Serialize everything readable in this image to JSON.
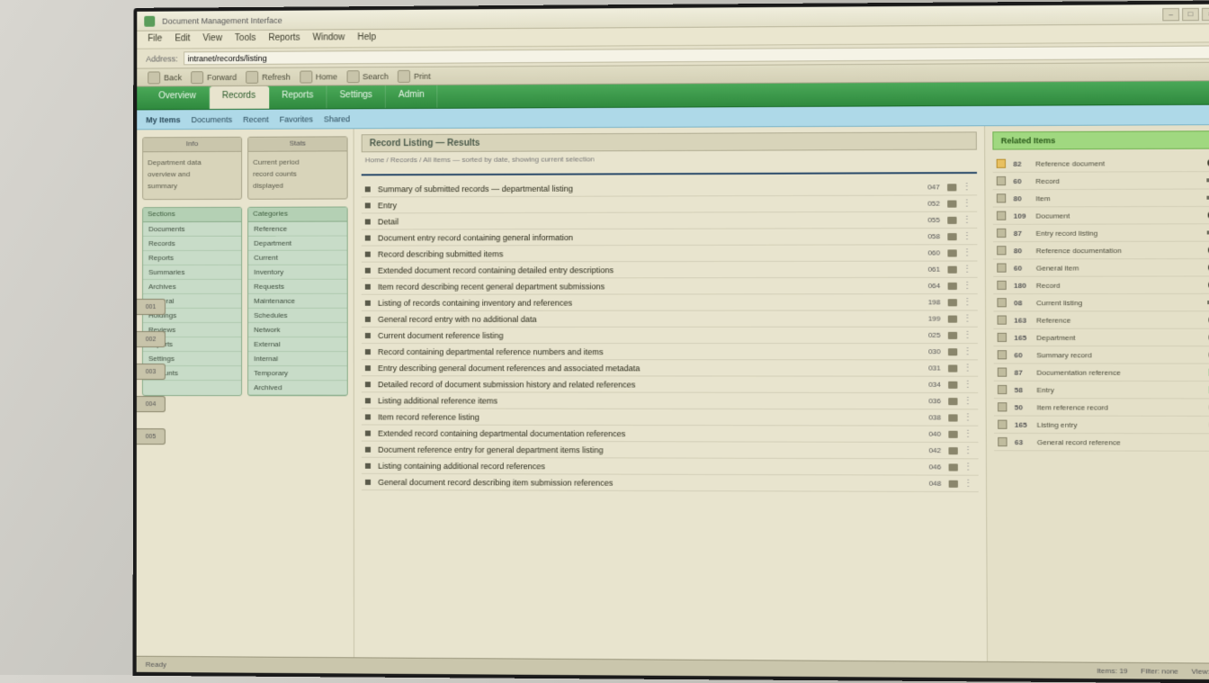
{
  "titlebar": {
    "text": "Document Management Interface"
  },
  "menubar": [
    "File",
    "Edit",
    "View",
    "Tools",
    "Reports",
    "Window",
    "Help"
  ],
  "address": {
    "label": "Address:",
    "value": "intranet/records/listing"
  },
  "toolbar": [
    "Back",
    "Forward",
    "Refresh",
    "Home",
    "Search",
    "Print"
  ],
  "ribbon": {
    "tabs": [
      "Overview",
      "Records",
      "Reports",
      "Settings",
      "Admin"
    ],
    "active": 1
  },
  "subbar": {
    "left": "My Items",
    "links": [
      "Documents",
      "Recent",
      "Favorites",
      "Shared"
    ]
  },
  "left": {
    "card1": {
      "header": "Info",
      "lines": [
        "Department data",
        "overview and",
        "summary"
      ]
    },
    "card2": {
      "header": "Stats",
      "lines": [
        "Current period",
        "record counts",
        "displayed"
      ]
    },
    "listA": {
      "header": "Sections",
      "items": [
        "Documents",
        "Records",
        "Reports",
        "Summaries",
        "Archives",
        "General",
        "Holdings",
        "Reviews",
        "Exports",
        "Settings",
        "Accounts"
      ]
    },
    "listB": {
      "header": "Categories",
      "items": [
        "Reference",
        "Department",
        "Current",
        "Inventory",
        "Requests",
        "Maintenance",
        "Schedules",
        "Network",
        "External",
        "Internal",
        "Temporary",
        "Archived"
      ]
    }
  },
  "sidetags": [
    "001",
    "002",
    "003",
    "004",
    "005"
  ],
  "mid": {
    "header": "Record Listing — Results",
    "crumb": "Home / Records / All items — sorted by date, showing current selection",
    "rows": [
      {
        "text": "Summary of submitted records — departmental listing",
        "num": "047"
      },
      {
        "text": "Entry",
        "num": "052"
      },
      {
        "text": "Detail",
        "num": "055"
      },
      {
        "text": "Document entry record containing general information",
        "num": "058"
      },
      {
        "text": "Record describing submitted items",
        "num": "060"
      },
      {
        "text": "Extended document record containing detailed entry descriptions",
        "num": "061"
      },
      {
        "text": "Item record describing recent general department submissions",
        "num": "064"
      },
      {
        "text": "Listing of records containing inventory and references",
        "num": "198"
      },
      {
        "text": "General record entry with no additional data",
        "num": "199"
      },
      {
        "text": "Current document reference listing",
        "num": "025"
      },
      {
        "text": "Record containing departmental reference numbers and items",
        "num": "030"
      },
      {
        "text": "Entry describing general document references and associated metadata",
        "num": "031"
      },
      {
        "text": "Detailed record of document submission history and related references",
        "num": "034"
      },
      {
        "text": "Listing additional reference items",
        "num": "036"
      },
      {
        "text": "Item record reference listing",
        "num": "038"
      },
      {
        "text": "Extended record containing departmental documentation references",
        "num": "040"
      },
      {
        "text": "Document reference entry for general department items listing",
        "num": "042"
      },
      {
        "text": "Listing containing additional record references",
        "num": "046"
      },
      {
        "text": "General document record describing item submission references",
        "num": "048"
      }
    ]
  },
  "right": {
    "header": "Related Items",
    "rows": [
      {
        "num": "82",
        "text": "Reference document",
        "end": "dot",
        "y": true
      },
      {
        "num": "60",
        "text": "Record",
        "end": "bar"
      },
      {
        "num": "80",
        "text": "Item",
        "end": "bar"
      },
      {
        "num": "109",
        "text": "Document",
        "end": "dot"
      },
      {
        "num": "87",
        "text": "Entry record listing",
        "end": "bar"
      },
      {
        "num": "80",
        "text": "Reference documentation",
        "end": "dot"
      },
      {
        "num": "60",
        "text": "General item",
        "end": "dot"
      },
      {
        "num": "180",
        "text": "Record",
        "end": "dot"
      },
      {
        "num": "08",
        "text": "Current listing",
        "end": "bar"
      },
      {
        "num": "163",
        "text": "Reference",
        "end": "dot"
      },
      {
        "num": "165",
        "text": "Department",
        "end": "dot"
      },
      {
        "num": "60",
        "text": "Summary record",
        "end": "dot"
      },
      {
        "num": "87",
        "text": "Documentation reference",
        "end": "sq"
      },
      {
        "num": "58",
        "text": "Entry",
        "end": "sq"
      },
      {
        "num": "50",
        "text": "Item reference record",
        "end": "dot"
      },
      {
        "num": "165",
        "text": "Listing entry",
        "end": "dot"
      },
      {
        "num": "63",
        "text": "General record reference",
        "end": "dot"
      }
    ]
  },
  "status": {
    "left": "Ready",
    "items": [
      "Items: 19",
      "Filter: none",
      "View: list"
    ]
  }
}
